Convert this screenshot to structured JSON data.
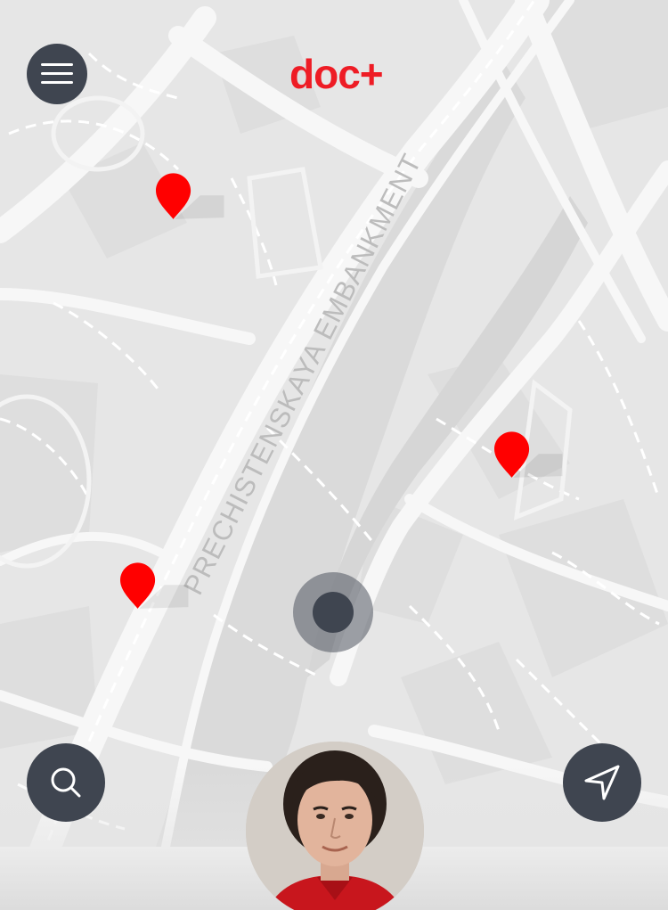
{
  "app": {
    "logo_text": "doc+",
    "brand_color": "#ee1c25"
  },
  "map": {
    "street_label": "PRECHISTENSKAYA EMBANKMENT",
    "pin_color": "#ff0000",
    "pins": [
      {
        "label": "clinic-pin-1"
      },
      {
        "label": "clinic-pin-2"
      },
      {
        "label": "clinic-pin-3"
      }
    ]
  },
  "controls": {
    "menu_icon": "hamburger-icon",
    "search_icon": "search-icon",
    "locate_icon": "navigation-arrow-icon",
    "button_color": "#3f4550"
  },
  "doctor": {
    "avatar": "doctor-avatar"
  }
}
